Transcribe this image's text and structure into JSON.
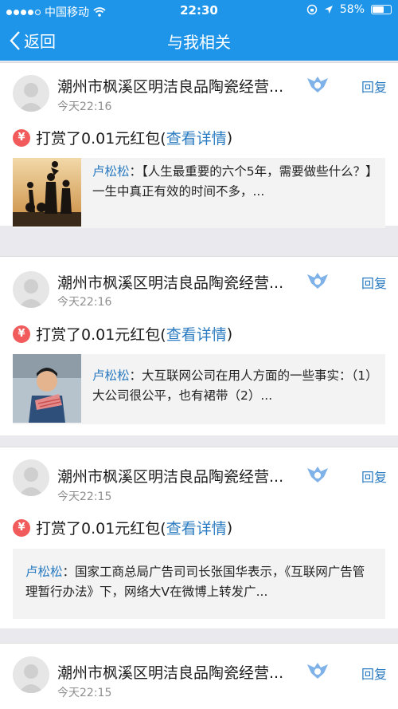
{
  "status_bar": {
    "carrier": "中国移动",
    "time": "22:30",
    "battery": "58%",
    "battery_level": 0.58
  },
  "nav": {
    "back_label": "返回",
    "title": "与我相关"
  },
  "icons": {
    "back": "chevron-left-icon",
    "avatar": "default-avatar-icon",
    "badge": "vip-wings-badge-icon",
    "reward": "red-envelope-yen-icon"
  },
  "colors": {
    "header": "#1e95e9",
    "link": "#2a7bc1",
    "reward_icon": "#f15b5b"
  },
  "items": [
    {
      "user": "潮州市枫溪区明洁良品陶瓷经营...",
      "time": "今天22:16",
      "reply": "回复",
      "reward_text": "打赏了0.01元红包(",
      "reward_link": "查看详情",
      "reward_close": ")",
      "quote_author": "卢松松",
      "quote_text": "：【人生最重要的六个5年，需要做些什么？】一生中真正有效的时间不多，..."
    },
    {
      "user": "潮州市枫溪区明洁良品陶瓷经营...",
      "time": "今天22:16",
      "reply": "回复",
      "reward_text": "打赏了0.01元红包(",
      "reward_link": "查看详情",
      "reward_close": ")",
      "quote_author": "卢松松",
      "quote_text": "：大互联网公司在用人方面的一些事实：（1）大公司很公平，也有裙带（2）..."
    },
    {
      "user": "潮州市枫溪区明洁良品陶瓷经营...",
      "time": "今天22:15",
      "reply": "回复",
      "reward_text": "打赏了0.01元红包(",
      "reward_link": "查看详情",
      "reward_close": ")",
      "quote_author": "卢松松",
      "quote_text": "：国家工商总局广告司司长张国华表示，《互联网广告管理暂行办法》下，网络大V在微博上转发广..."
    },
    {
      "user": "潮州市枫溪区明洁良品陶瓷经营...",
      "time": "今天22:15",
      "reply": "回复"
    }
  ]
}
